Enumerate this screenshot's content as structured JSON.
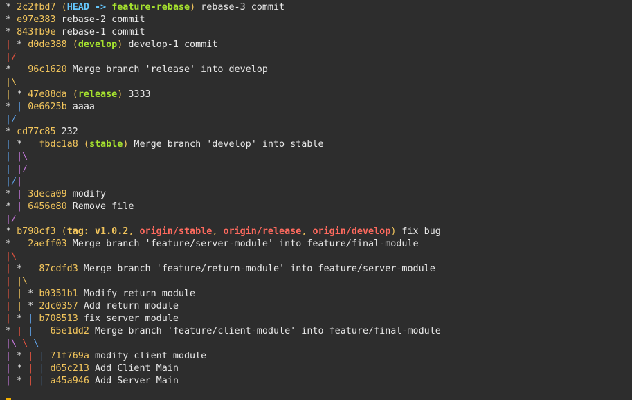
{
  "colors": {
    "background": "#2d2d2d",
    "text": "#e8e8e8",
    "hash": "#f2c55c",
    "head": "#66c9ff",
    "branch": "#a6e22e",
    "remote": "#ff6a5e",
    "tag": "#f2c55c",
    "graph_red": "#e5533f",
    "graph_yellow": "#f2c55c",
    "graph_blue": "#5fa2e8",
    "graph_purple": "#c678dd",
    "cursor": "#f4b000"
  },
  "lines": [
    {
      "segs": [
        {
          "t": "* ",
          "c": "text"
        },
        {
          "t": "2c2fbd7",
          "c": "hash"
        },
        {
          "t": " (",
          "c": "hash"
        },
        {
          "t": "HEAD -> ",
          "c": "head",
          "b": true
        },
        {
          "t": "feature-rebase",
          "c": "branch",
          "b": true
        },
        {
          "t": ")",
          "c": "hash"
        },
        {
          "t": " rebase-3 commit",
          "c": "text"
        }
      ]
    },
    {
      "segs": [
        {
          "t": "* ",
          "c": "text"
        },
        {
          "t": "e97e383",
          "c": "hash"
        },
        {
          "t": " rebase-2 commit",
          "c": "text"
        }
      ]
    },
    {
      "segs": [
        {
          "t": "* ",
          "c": "text"
        },
        {
          "t": "843fb9e",
          "c": "hash"
        },
        {
          "t": " rebase-1 commit",
          "c": "text"
        }
      ]
    },
    {
      "segs": [
        {
          "t": "| ",
          "c": "graph_red"
        },
        {
          "t": "* ",
          "c": "text"
        },
        {
          "t": "d0de388",
          "c": "hash"
        },
        {
          "t": " (",
          "c": "hash"
        },
        {
          "t": "develop",
          "c": "branch",
          "b": true
        },
        {
          "t": ")",
          "c": "hash"
        },
        {
          "t": " develop-1 commit",
          "c": "text"
        }
      ]
    },
    {
      "segs": [
        {
          "t": "|/",
          "c": "graph_red"
        }
      ]
    },
    {
      "segs": [
        {
          "t": "*   ",
          "c": "text"
        },
        {
          "t": "96c1620",
          "c": "hash"
        },
        {
          "t": " Merge branch 'release' into develop",
          "c": "text"
        }
      ]
    },
    {
      "segs": [
        {
          "t": "|\\",
          "c": "graph_yellow"
        }
      ]
    },
    {
      "segs": [
        {
          "t": "| ",
          "c": "graph_yellow"
        },
        {
          "t": "* ",
          "c": "text"
        },
        {
          "t": "47e88da",
          "c": "hash"
        },
        {
          "t": " (",
          "c": "hash"
        },
        {
          "t": "release",
          "c": "branch",
          "b": true
        },
        {
          "t": ")",
          "c": "hash"
        },
        {
          "t": " 3333",
          "c": "text"
        }
      ]
    },
    {
      "segs": [
        {
          "t": "* ",
          "c": "text"
        },
        {
          "t": "| ",
          "c": "graph_blue"
        },
        {
          "t": "0e6625b",
          "c": "hash"
        },
        {
          "t": " aaaa",
          "c": "text"
        }
      ]
    },
    {
      "segs": [
        {
          "t": "|/",
          "c": "graph_blue"
        }
      ]
    },
    {
      "segs": [
        {
          "t": "* ",
          "c": "text"
        },
        {
          "t": "cd77c85",
          "c": "hash"
        },
        {
          "t": " 232",
          "c": "text"
        }
      ]
    },
    {
      "segs": [
        {
          "t": "| ",
          "c": "graph_blue"
        },
        {
          "t": "*   ",
          "c": "text"
        },
        {
          "t": "fbdc1a8",
          "c": "hash"
        },
        {
          "t": " (",
          "c": "hash"
        },
        {
          "t": "stable",
          "c": "branch",
          "b": true
        },
        {
          "t": ")",
          "c": "hash"
        },
        {
          "t": " Merge branch 'develop' into stable",
          "c": "text"
        }
      ]
    },
    {
      "segs": [
        {
          "t": "| ",
          "c": "graph_blue"
        },
        {
          "t": "|\\",
          "c": "graph_purple"
        }
      ]
    },
    {
      "segs": [
        {
          "t": "| ",
          "c": "graph_blue"
        },
        {
          "t": "|/",
          "c": "graph_purple"
        }
      ]
    },
    {
      "segs": [
        {
          "t": "|/",
          "c": "graph_blue"
        },
        {
          "t": "|",
          "c": "graph_purple"
        }
      ]
    },
    {
      "segs": [
        {
          "t": "* ",
          "c": "text"
        },
        {
          "t": "| ",
          "c": "graph_purple"
        },
        {
          "t": "3deca09",
          "c": "hash"
        },
        {
          "t": " modify",
          "c": "text"
        }
      ]
    },
    {
      "segs": [
        {
          "t": "* ",
          "c": "text"
        },
        {
          "t": "| ",
          "c": "graph_purple"
        },
        {
          "t": "6456e80",
          "c": "hash"
        },
        {
          "t": " Remove file",
          "c": "text"
        }
      ]
    },
    {
      "segs": [
        {
          "t": "|/",
          "c": "graph_purple"
        }
      ]
    },
    {
      "segs": [
        {
          "t": "* ",
          "c": "text"
        },
        {
          "t": "b798cf3",
          "c": "hash"
        },
        {
          "t": " (",
          "c": "hash"
        },
        {
          "t": "tag: v1.0.2",
          "c": "tag",
          "b": true
        },
        {
          "t": ", ",
          "c": "hash"
        },
        {
          "t": "origin/stable",
          "c": "remote",
          "b": true
        },
        {
          "t": ", ",
          "c": "hash"
        },
        {
          "t": "origin/release",
          "c": "remote",
          "b": true
        },
        {
          "t": ", ",
          "c": "hash"
        },
        {
          "t": "origin/develop",
          "c": "remote",
          "b": true
        },
        {
          "t": ")",
          "c": "hash"
        },
        {
          "t": " fix bug",
          "c": "text"
        }
      ]
    },
    {
      "segs": [
        {
          "t": "*   ",
          "c": "text"
        },
        {
          "t": "2aeff03",
          "c": "hash"
        },
        {
          "t": " Merge branch 'feature/server-module' into feature/final-module",
          "c": "text"
        }
      ]
    },
    {
      "segs": [
        {
          "t": "|\\",
          "c": "graph_red"
        }
      ]
    },
    {
      "segs": [
        {
          "t": "| ",
          "c": "graph_red"
        },
        {
          "t": "*   ",
          "c": "text"
        },
        {
          "t": "87cdfd3",
          "c": "hash"
        },
        {
          "t": " Merge branch 'feature/return-module' into feature/server-module",
          "c": "text"
        }
      ]
    },
    {
      "segs": [
        {
          "t": "| ",
          "c": "graph_red"
        },
        {
          "t": "|\\",
          "c": "graph_yellow"
        }
      ]
    },
    {
      "segs": [
        {
          "t": "| ",
          "c": "graph_red"
        },
        {
          "t": "| ",
          "c": "graph_yellow"
        },
        {
          "t": "* ",
          "c": "text"
        },
        {
          "t": "b0351b1",
          "c": "hash"
        },
        {
          "t": " Modify return module",
          "c": "text"
        }
      ]
    },
    {
      "segs": [
        {
          "t": "| ",
          "c": "graph_red"
        },
        {
          "t": "| ",
          "c": "graph_yellow"
        },
        {
          "t": "* ",
          "c": "text"
        },
        {
          "t": "2dc0357",
          "c": "hash"
        },
        {
          "t": " Add return module",
          "c": "text"
        }
      ]
    },
    {
      "segs": [
        {
          "t": "| ",
          "c": "graph_red"
        },
        {
          "t": "* ",
          "c": "text"
        },
        {
          "t": "| ",
          "c": "graph_blue"
        },
        {
          "t": "b708513",
          "c": "hash"
        },
        {
          "t": " fix server module",
          "c": "text"
        }
      ]
    },
    {
      "segs": [
        {
          "t": "* ",
          "c": "text"
        },
        {
          "t": "| ",
          "c": "graph_red"
        },
        {
          "t": "|   ",
          "c": "graph_blue"
        },
        {
          "t": "65e1dd2",
          "c": "hash"
        },
        {
          "t": " Merge branch 'feature/client-module' into feature/final-module",
          "c": "text"
        }
      ]
    },
    {
      "segs": [
        {
          "t": "|\\",
          "c": "graph_purple"
        },
        {
          "t": " \\",
          "c": "graph_red"
        },
        {
          "t": " \\",
          "c": "graph_blue"
        }
      ]
    },
    {
      "segs": [
        {
          "t": "| ",
          "c": "graph_purple"
        },
        {
          "t": "* ",
          "c": "text"
        },
        {
          "t": "| ",
          "c": "graph_red"
        },
        {
          "t": "| ",
          "c": "graph_blue"
        },
        {
          "t": "71f769a",
          "c": "hash"
        },
        {
          "t": " modify client module",
          "c": "text"
        }
      ]
    },
    {
      "segs": [
        {
          "t": "| ",
          "c": "graph_purple"
        },
        {
          "t": "* ",
          "c": "text"
        },
        {
          "t": "| ",
          "c": "graph_red"
        },
        {
          "t": "| ",
          "c": "graph_blue"
        },
        {
          "t": "d65c213",
          "c": "hash"
        },
        {
          "t": " Add Client Main",
          "c": "text"
        }
      ]
    },
    {
      "segs": [
        {
          "t": "| ",
          "c": "graph_purple"
        },
        {
          "t": "* ",
          "c": "text"
        },
        {
          "t": "| ",
          "c": "graph_red"
        },
        {
          "t": "| ",
          "c": "graph_blue"
        },
        {
          "t": "a45a946",
          "c": "hash"
        },
        {
          "t": " Add Server Main",
          "c": "text"
        }
      ]
    }
  ]
}
